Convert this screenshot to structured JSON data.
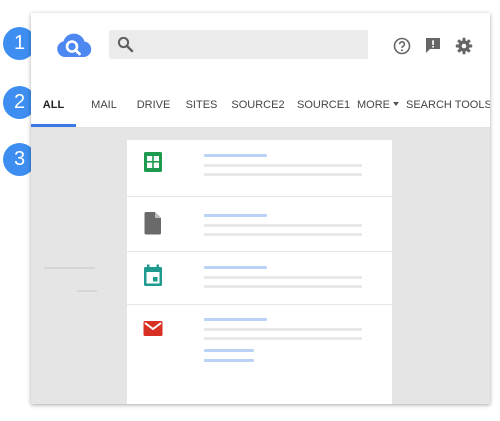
{
  "badges": [
    "1",
    "2",
    "3"
  ],
  "search": {
    "placeholder": "",
    "value": ""
  },
  "header_icons": [
    "help-icon",
    "feedback-icon",
    "settings-icon"
  ],
  "tabs": [
    {
      "label": "ALL",
      "active": true
    },
    {
      "label": "MAIL",
      "active": false
    },
    {
      "label": "DRIVE",
      "active": false
    },
    {
      "label": "SITES",
      "active": false
    },
    {
      "label": "SOURCE2",
      "active": false
    },
    {
      "label": "SOURCE1",
      "active": false
    },
    {
      "label": "MORE",
      "active": false
    },
    {
      "label": "SEARCH TOOLS",
      "active": false
    }
  ],
  "results": [
    {
      "icon": "sheets-icon",
      "color": "#1e9a4f"
    },
    {
      "icon": "document-icon",
      "color": "#6a6a6a"
    },
    {
      "icon": "calendar-icon",
      "color": "#1f9a8e"
    },
    {
      "icon": "mail-icon",
      "color": "#d93025"
    }
  ],
  "colors": {
    "accent": "#3b78e7",
    "badge": "#3d8ef0",
    "logo": "#4c87f2"
  }
}
